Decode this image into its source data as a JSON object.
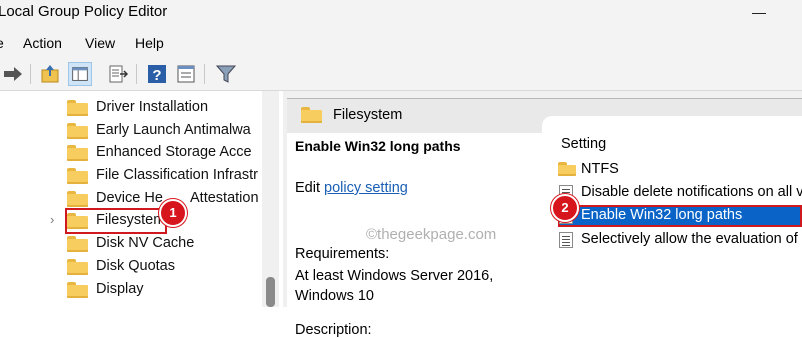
{
  "window": {
    "title": "Local Group Policy Editor"
  },
  "menu": [
    "e",
    "Action",
    "View",
    "Help"
  ],
  "toolbar": {
    "icons": [
      "forward-arrow-icon",
      "up-folder-icon",
      "show-hide-console-tree-icon",
      "export-list-icon",
      "help-icon",
      "properties-icon",
      "filter-icon"
    ]
  },
  "tree": {
    "items": [
      {
        "label": "Driver Installation"
      },
      {
        "label": "Early Launch Antimalwa"
      },
      {
        "label": "Enhanced Storage Acce"
      },
      {
        "label": "File Classification Infrastr"
      },
      {
        "label": "Device He",
        "label_tail": "Attestation"
      },
      {
        "label": "Filesystem"
      },
      {
        "label": "Disk NV Cache"
      },
      {
        "label": "Disk Quotas"
      },
      {
        "label": "Display"
      }
    ],
    "expander": "›"
  },
  "annotations": {
    "badge1": "1",
    "badge2": "2"
  },
  "details": {
    "header_title": "Filesystem",
    "policy_title": "Enable Win32 long paths",
    "edit_prefix": "Edit",
    "edit_link": "policy setting",
    "requirements_label": "Requirements:",
    "requirements_value": "At least Windows Server 2016, Windows 10",
    "description_label": "Description:"
  },
  "settings": {
    "column_header": "Setting",
    "rows": [
      {
        "label": "NTFS",
        "type": "folder"
      },
      {
        "label": "Disable delete notifications on all v",
        "type": "policy"
      },
      {
        "label": "Enable Win32 long paths",
        "type": "policy",
        "selected": true
      },
      {
        "label": "Selectively allow the evaluation of",
        "type": "policy"
      }
    ]
  },
  "watermark": "©thegeekpage.com",
  "colors": {
    "selection": "#0a64c8",
    "annotation_red": "#d7151c",
    "link": "#1a5fb4"
  }
}
